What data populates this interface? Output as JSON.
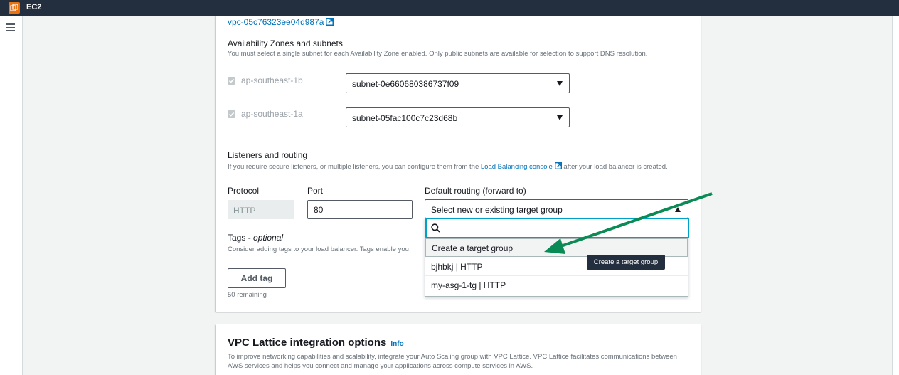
{
  "topbar": {
    "service": "EC2"
  },
  "vpc": {
    "id": "vpc-05c76323ee04d987a"
  },
  "az": {
    "title": "Availability Zones and subnets",
    "description": "You must select a single subnet for each Availability Zone enabled. Only public subnets are available for selection to support DNS resolution.",
    "rows": [
      {
        "zone": "ap-southeast-1b",
        "subnet": "subnet-0e660680386737f09"
      },
      {
        "zone": "ap-southeast-1a",
        "subnet": "subnet-05fac100c7c23d68b"
      }
    ]
  },
  "listeners": {
    "title": "Listeners and routing",
    "desc_before": "If you require secure listeners, or multiple listeners, you can configure them from the ",
    "desc_link": "Load Balancing console",
    "desc_after": " after your load balancer is created.",
    "protocol_label": "Protocol",
    "port_label": "Port",
    "routing_label": "Default routing (forward to)",
    "protocol_value": "HTTP",
    "port_value": "80",
    "routing_placeholder": "Select new or existing target group"
  },
  "dropdown": {
    "options": [
      "Create a target group",
      "bjhbkj | HTTP",
      "my-asg-1-tg | HTTP"
    ],
    "tooltip": "Create a target group"
  },
  "tags": {
    "title": "Tags",
    "optional": "optional",
    "desc": "Consider adding tags to your load balancer. Tags enable you",
    "add_button": "Add tag",
    "remaining": "50 remaining"
  },
  "lattice": {
    "title": "VPC Lattice integration options",
    "info": "Info",
    "desc": "To improve networking capabilities and scalability, integrate your Auto Scaling group with VPC Lattice. VPC Lattice facilitates communications between AWS services and helps you connect and manage your applications across compute services in AWS."
  },
  "colors": {
    "topbar": "#232f3e",
    "link": "#0073bb",
    "focus": "#00a1c9",
    "annotation_arrow": "#0a8a54"
  }
}
